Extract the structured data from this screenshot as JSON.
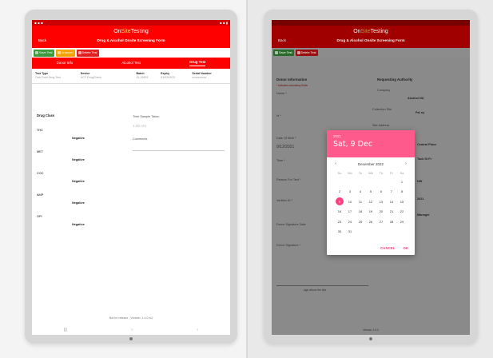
{
  "left": {
    "brand": {
      "a": "On",
      "b": "Site",
      "c": "Testing"
    },
    "back_label": "Back",
    "form_title": "Drug & Alcohol Onsite Screening Form",
    "toolbar": {
      "save": "Save Test",
      "unsaved": "Unsaved",
      "delete": "Delete Test"
    },
    "tabs": [
      "Donor Info",
      "Alcohol Test",
      "Drug Test"
    ],
    "info": [
      {
        "label": "Test Type",
        "value": "Oral Fluid Drug Test"
      },
      {
        "label": "Device",
        "value": "UCT DrugCheck"
      },
      {
        "label": "Batch",
        "value": "OL19003"
      },
      {
        "label": "Expiry",
        "value": "31/03/2022"
      },
      {
        "label": "Serial Number",
        "value": "xxxxxxxxxx"
      }
    ],
    "drug_class_label": "Drug Class",
    "drugs": [
      {
        "name": "THC",
        "result": "Negative"
      },
      {
        "name": "MET",
        "result": "Negative"
      },
      {
        "name": "COC",
        "result": "Negative"
      },
      {
        "name": "AMP",
        "result": "Negative"
      },
      {
        "name": "OPI",
        "result": "Negative"
      }
    ],
    "time_label": "Time Sample Taken",
    "time_value": "1:00 AM",
    "comments_label": "Comments",
    "footer": "Not for release · Version: 1.4.0 rc2"
  },
  "right": {
    "donor_info": "Donor Information",
    "indicates": "* indicates mandatory fields",
    "requesting": "Requesting Authority",
    "company_label": "Company",
    "company_value": "Alcohol NU",
    "collection_site": "Collection Site",
    "collection_value": "Pai ny",
    "site_address": "Site Address",
    "address_lines": [
      "Central Place",
      "Tack St Fr"
    ],
    "nw_label": "NW",
    "date_label": "Date Of Birth *",
    "date_value": "9/12/2021",
    "time_label": "Time *",
    "reason_label": "Reason For Test *",
    "verified_label": "Verified ID *",
    "mgr_label": "Manager",
    "donor_sig_date": "Donor Signature Date",
    "donor_sig": "Donor Signature *",
    "sign_above": "sign above the line",
    "version": "Version 1.5.0",
    "name_label": "Name *",
    "id_label": "Id *",
    "code_val": "2021",
    "calendar": {
      "year": "2021",
      "date": "Sat, 9 Dec",
      "month": "December 2022",
      "weekdays": [
        "Su",
        "Mo",
        "Tu",
        "We",
        "Th",
        "Fr",
        "Sa"
      ],
      "selected": "9",
      "cancel": "CANCEL",
      "ok": "OK"
    }
  }
}
